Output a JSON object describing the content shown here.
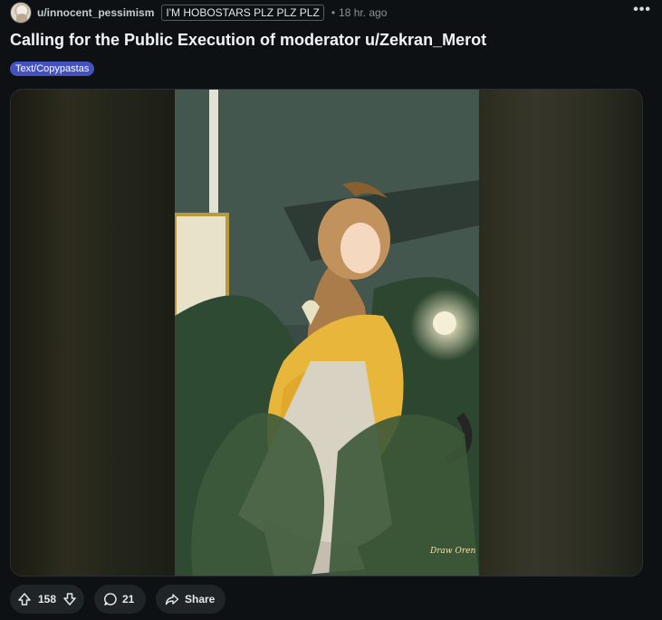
{
  "post": {
    "author": "u/innocent_pessimism",
    "author_flair": "I'M HOBOSTARS PLZ PLZ PLZ",
    "separator": "•",
    "time": "18 hr. ago",
    "more_label": "•••",
    "title": "Calling for the Public Execution of moderator u/Zekran_Merot",
    "post_flair": "Text/Copypastas"
  },
  "image": {
    "signature": "Draw Oren"
  },
  "actions": {
    "upvotes": "158",
    "comments": "21",
    "share_label": "Share"
  },
  "colors": {
    "background": "#0e1113",
    "flair": "#4452bf",
    "pill": "#1f2426"
  },
  "icons": [
    "user-avatar",
    "more-icon",
    "upvote-icon",
    "downvote-icon",
    "comment-icon",
    "share-icon"
  ]
}
